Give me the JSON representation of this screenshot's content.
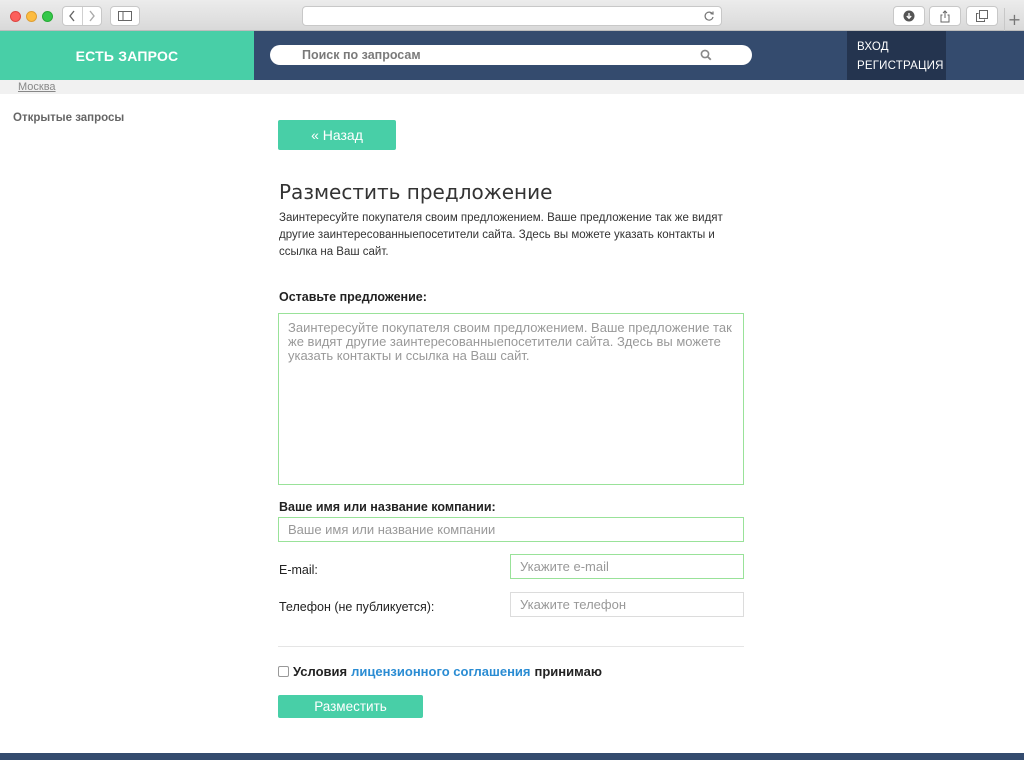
{
  "browser": {
    "plus_label": "+"
  },
  "header": {
    "logo": "ЕСТЬ ЗАПРОС",
    "search_placeholder": "Поиск по запросам",
    "login": "ВХОД",
    "register": "РЕГИСТРАЦИЯ"
  },
  "city": "Москва",
  "sidebar": {
    "open_requests": "Открытые запросы"
  },
  "back_button": "« Назад",
  "form": {
    "title": "Разместить предложение",
    "description": "Заинтересуйте покупателя своим предложением. Ваше предложение так же видят другие заинтересованныепосетители сайта. Здесь вы можете указать контакты и ссылка на Ваш сайт.",
    "offer_label": "Оставьте предложение:",
    "offer_placeholder": "Заинтересуйте покупателя своим предложением. Ваше предложение так же видят другие заинтересованныепосетители сайта. Здесь вы можете указать контакты и ссылка на Ваш сайт.",
    "name_label": "Ваше имя или название компании:",
    "name_placeholder": "Ваше имя или название компании",
    "email_label": "E-mail:",
    "email_placeholder": "Укажите e-mail",
    "phone_label": "Телефон (не публикуется):",
    "phone_placeholder": "Укажите телефон",
    "agree_prefix": "Условия",
    "agree_link": "лицензионного соглашения",
    "agree_suffix": "принимаю",
    "agree_checked": false,
    "submit": "Разместить"
  },
  "colors": {
    "accent": "#48cfa7",
    "header_bg": "#344b6e",
    "auth_bg": "#24344f",
    "input_border": "#99e299",
    "link": "#2a8cd3"
  }
}
